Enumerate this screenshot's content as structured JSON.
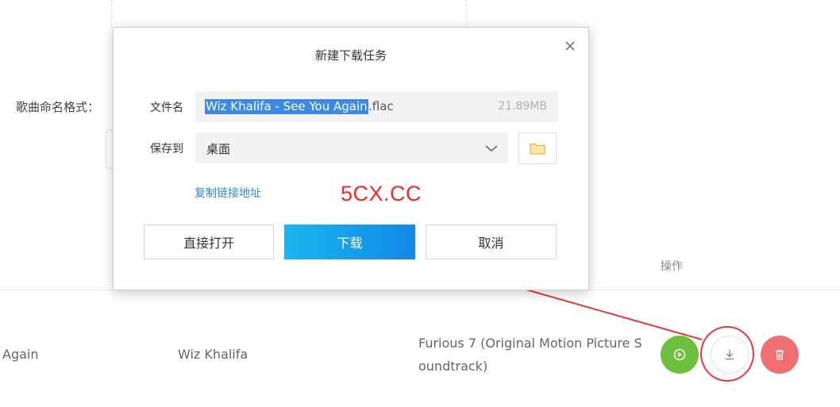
{
  "background": {
    "naming_label": "歌曲命名格式：",
    "table_header_action": "操作",
    "row": {
      "title": "Again",
      "artist": "Wiz Khalifa",
      "album_line1": "Furious 7 (Original Motion Picture S",
      "album_line2": "oundtrack)"
    },
    "action_icons": [
      "play-icon",
      "download-icon",
      "trash-icon"
    ]
  },
  "dialog": {
    "title": "新建下载任务",
    "filename_label": "文件名",
    "filename_selected": "Wiz Khalifa - See You Again",
    "filename_ext": ".flac",
    "file_size": "21.89MB",
    "save_to_label": "保存到",
    "save_to_value": "桌面",
    "copy_link": "复制链接地址",
    "buttons": {
      "open": "直接打开",
      "download": "下载",
      "cancel": "取消"
    }
  },
  "watermark": "5CX.CC",
  "colors": {
    "accent_blue": "#1289e6",
    "selection_blue": "#3c8ae6",
    "play_green": "#6cc03c",
    "delete_red": "#ef6f72",
    "annotation_red": "#e43a3f"
  }
}
